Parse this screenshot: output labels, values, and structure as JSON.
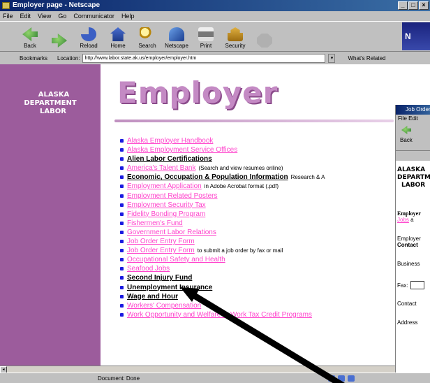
{
  "window": {
    "title": "Employer page - Netscape"
  },
  "menu": [
    "File",
    "Edit",
    "View",
    "Go",
    "Communicator",
    "Help"
  ],
  "toolbar": {
    "buttons": [
      {
        "label": "Back",
        "icon": "back-icon"
      },
      {
        "label": "",
        "icon": "forward-icon"
      },
      {
        "label": "Reload",
        "icon": "reload-icon"
      },
      {
        "label": "Home",
        "icon": "home-icon"
      },
      {
        "label": "Search",
        "icon": "search-icon"
      },
      {
        "label": "Netscape",
        "icon": "netscape-icon"
      },
      {
        "label": "Print",
        "icon": "print-icon"
      },
      {
        "label": "Security",
        "icon": "security-icon"
      },
      {
        "label": "",
        "icon": "stop-icon"
      }
    ],
    "logo": "N"
  },
  "location": {
    "bookmarks": "Bookmarks",
    "label": "Location:",
    "url": "http://www.labor.state.ak.us/employer/employer.htm",
    "related": "What's Related"
  },
  "sidebar": {
    "logo_line1": "ALASKA",
    "logo_line2": "DEPARTMENT",
    "logo_line3": "LABOR"
  },
  "page": {
    "heading": "Employer"
  },
  "links": [
    {
      "text": "Alaska Employer Handbook",
      "style": "pink",
      "note": ""
    },
    {
      "text": "Alaska Employment Service Offices",
      "style": "pink",
      "note": ""
    },
    {
      "text": "Alien Labor Certifications",
      "style": "dark",
      "note": ""
    },
    {
      "text": "America's Talent Bank",
      "style": "pink",
      "note": "(Search and view resumes online)"
    },
    {
      "text": "Economic, Occupation & Population Information",
      "style": "dark",
      "note": "Research & A"
    },
    {
      "text": "Employment Application",
      "style": "pink",
      "note": "in Adobe Acrobat format (.pdf)"
    },
    {
      "text": "Employment Related Posters",
      "style": "pink",
      "note": ""
    },
    {
      "text": "Employment Security Tax",
      "style": "pink",
      "note": ""
    },
    {
      "text": "Fidelity Bonding Program",
      "style": "pink",
      "note": ""
    },
    {
      "text": "Fishermen's Fund",
      "style": "pink",
      "note": ""
    },
    {
      "text": "Government Labor Relations",
      "style": "pink",
      "note": ""
    },
    {
      "text": "Job Order Entry Form",
      "style": "pink",
      "note": ""
    },
    {
      "text": "Job Order Entry Form",
      "style": "pink",
      "note": "to submit a job order by fax or mail"
    },
    {
      "text": "Occupational Safety and Health",
      "style": "pink",
      "note": ""
    },
    {
      "text": "Seafood Jobs",
      "style": "pink",
      "note": ""
    },
    {
      "text": "Second Injury Fund",
      "style": "dark",
      "note": ""
    },
    {
      "text": "Unemployment Insurance",
      "style": "dark",
      "note": ""
    },
    {
      "text": "Wage and Hour",
      "style": "dark",
      "note": ""
    },
    {
      "text": "Workers' Compensation",
      "style": "pink",
      "note": ""
    },
    {
      "text": "Work Opportunity and Welfare to Work Tax Credit Programs",
      "style": "pink",
      "note": ""
    }
  ],
  "window2": {
    "title": "Job Order",
    "menu": "File Edit",
    "back": "Back",
    "logo_line1": "ALASKA",
    "logo_line2": "DEPARTMENT",
    "logo_line3": "LABOR",
    "employer_label": "Employer",
    "jobs_link": "Jobs",
    "jobs_rest": "a",
    "employer_line": "Employer",
    "contact_line": "Contact",
    "business": "Business",
    "fax": "Fax:",
    "contact": "Contact",
    "address": "Address"
  },
  "status": {
    "text": "Document: Done"
  },
  "colors": {
    "sidebar": "#9c5c9c",
    "heading": "#c48ac4",
    "link": "#ff44cc",
    "bullet": "#1a1ae0"
  }
}
